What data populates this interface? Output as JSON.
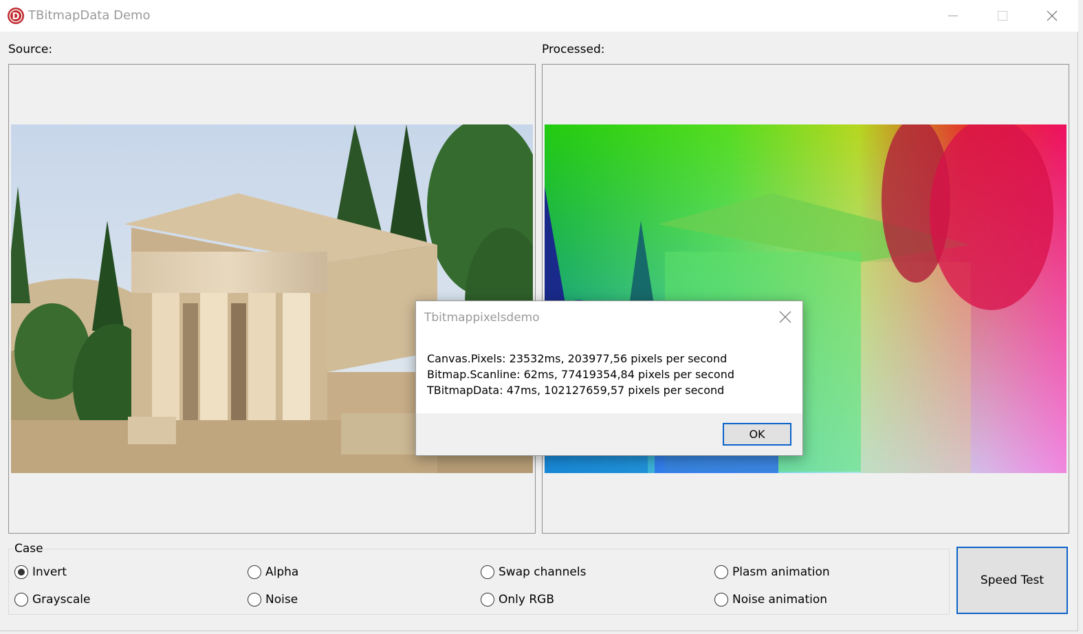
{
  "window": {
    "title": "TBitmapData Demo",
    "app_icon_letter": "D"
  },
  "panes": {
    "source_label": "Source:",
    "processed_label": "Processed:"
  },
  "case": {
    "legend": "Case",
    "options": [
      {
        "label": "Invert",
        "selected": true
      },
      {
        "label": "Alpha",
        "selected": false
      },
      {
        "label": "Swap channels",
        "selected": false
      },
      {
        "label": "Plasm animation",
        "selected": false
      },
      {
        "label": "Grayscale",
        "selected": false
      },
      {
        "label": "Noise",
        "selected": false
      },
      {
        "label": "Only RGB",
        "selected": false
      },
      {
        "label": "Noise animation",
        "selected": false
      }
    ]
  },
  "speed_test_label": "Speed Test",
  "dialog": {
    "title": "Tbitmappixelsdemo",
    "lines": [
      "Canvas.Pixels: 23532ms, 203977,56 pixels per second",
      "Bitmap.Scanline: 62ms, 77419354,84 pixels per second",
      "TBitmapData: 47ms, 102127659,57 pixels per second"
    ],
    "ok_label": "OK"
  },
  "colors": {
    "accent": "#0a62c9",
    "app_icon_red": "#c0282d"
  }
}
